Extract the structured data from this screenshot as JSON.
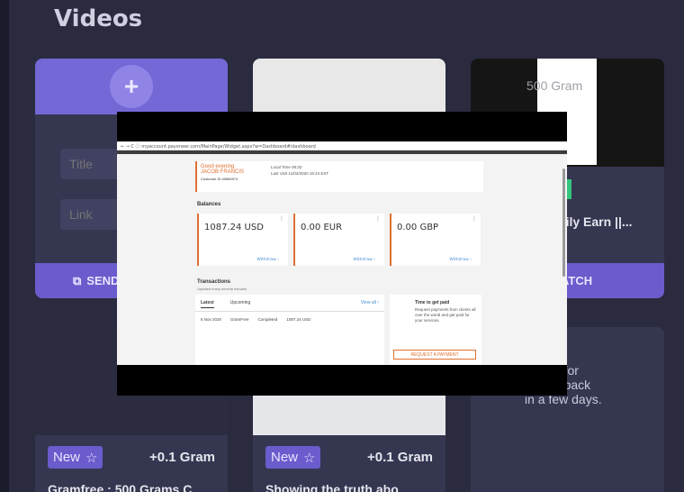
{
  "section_title": "Videos",
  "submit_card": {
    "title_placeholder": "Title",
    "link_placeholder": "Link",
    "send_label": "SEND"
  },
  "card3": {
    "thumb_text": "500 Gram",
    "title": "asily Earn ||...",
    "watch_label": "ATCH"
  },
  "videos": [
    {
      "badge": "New",
      "reward": "+0.1 Gram",
      "title": "Gramfree : 500 Grams C"
    },
    {
      "badge": "New",
      "reward": "+0.1 Gram",
      "title": "Showing the truth abo"
    }
  ],
  "card6_note": [
    "all for",
    "ome back",
    "in a few days."
  ],
  "player": {
    "url": "← → C  ⓘ myaccount.payoneer.com/MainPage/Widget.aspx?w=Dashboard#/dashboard",
    "greeting": "Good evening",
    "name": "JACOB FRANCIS",
    "customer_id": "Customer ID #9880974",
    "local_time": "Local Time   08:33",
    "last_visit": "Last Visit    11/03/2020 15:43 EST",
    "balances_heading": "Balances",
    "balances": [
      {
        "amount": "1087.24 USD",
        "action": "Withdraw ›"
      },
      {
        "amount": "0.00 EUR",
        "action": "Withdraw ›"
      },
      {
        "amount": "0.00 GBP",
        "action": "Withdraw ›"
      }
    ],
    "transactions_heading": "Transactions",
    "transactions_sub": "Updated every several minutes",
    "tab_latest": "Latest",
    "tab_upcoming": "Upcoming",
    "view_all": "View all ›",
    "tx_row": {
      "date": "6 Nov 2020",
      "payee": "GramFree",
      "status": "Completed",
      "amount": "1087.24 USD"
    },
    "get_paid_title": "Time to get paid",
    "get_paid_desc": "Request payments from clients all over the world and get paid for your services.",
    "request_button": "REQUEST A PAYMENT"
  },
  "colors": {
    "accent": "#6a5ccc",
    "background": "#2a2b3f",
    "payoneer_orange": "#e07030"
  }
}
